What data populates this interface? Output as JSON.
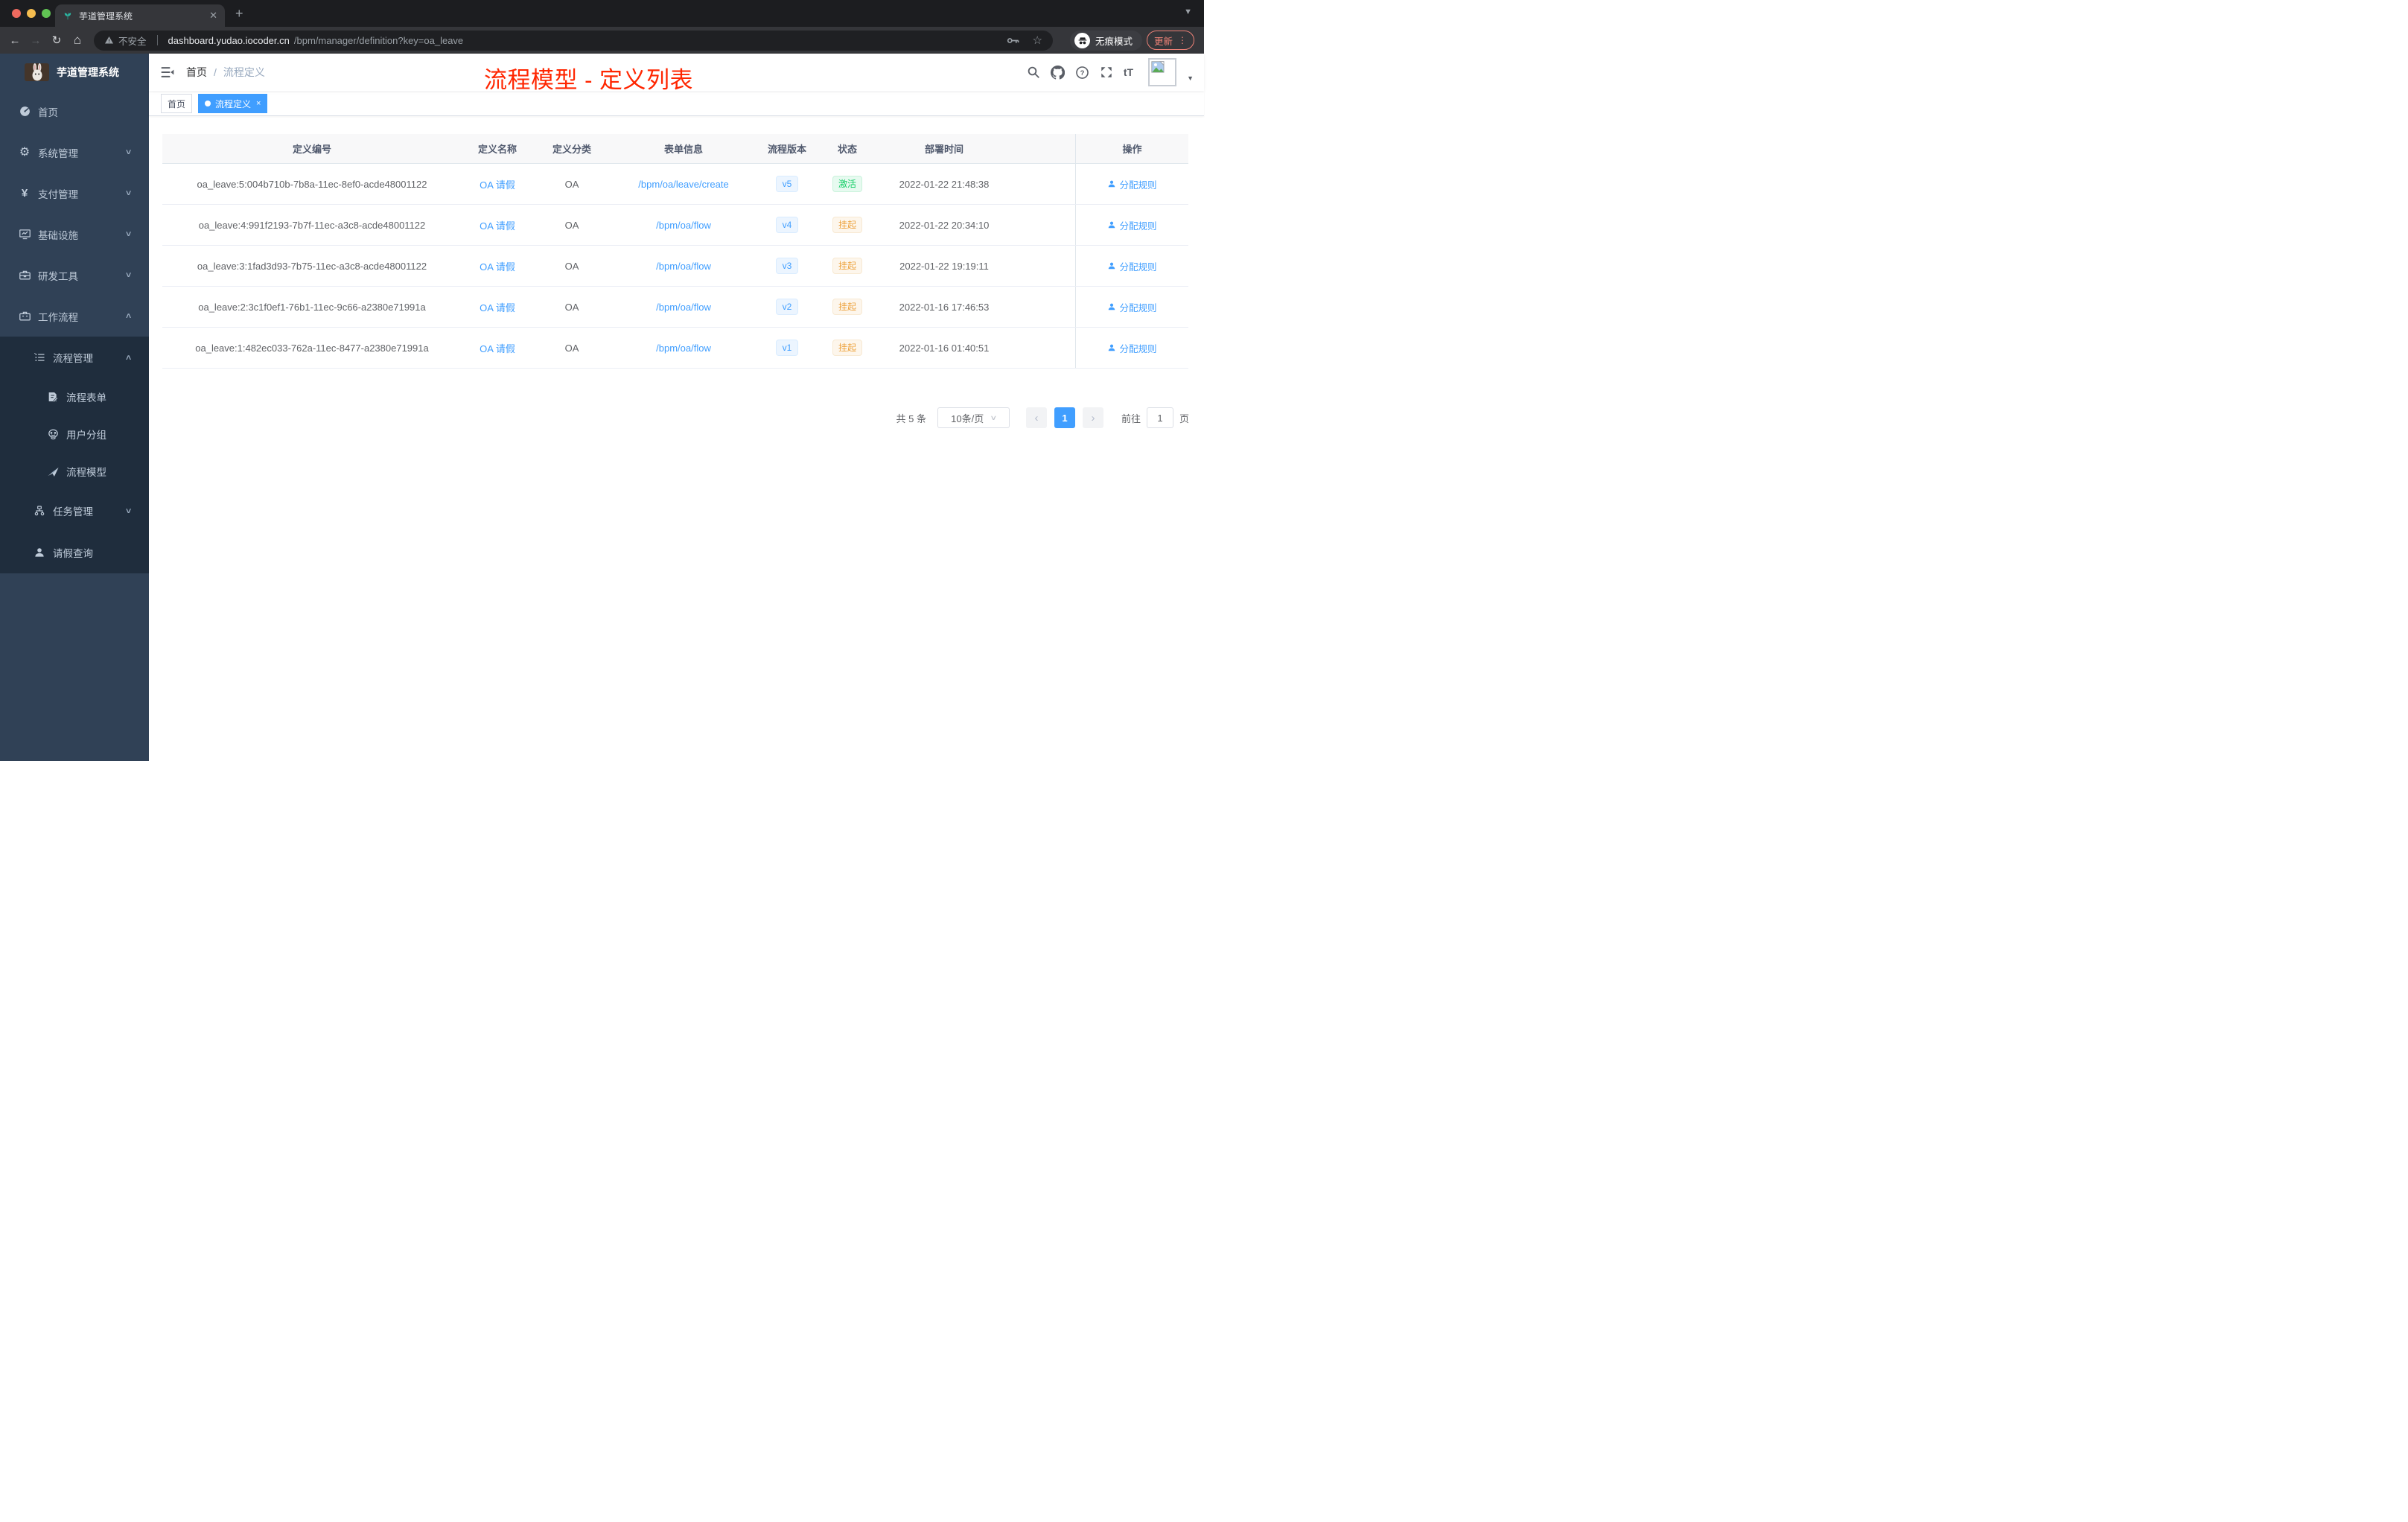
{
  "browser": {
    "tab_title": "芋道管理系统",
    "new_tab_label": "+",
    "close_tab_label": "✕",
    "security_label": "不安全",
    "url_host": "dashboard.yudao.iocoder.cn",
    "url_path": "/bpm/manager/definition?key=oa_leave",
    "incognito_label": "无痕模式",
    "update_label": "更新",
    "back_glyph": "←",
    "forward_glyph": "→",
    "reload_glyph": "↻",
    "home_glyph": "⌂"
  },
  "sidebar": {
    "app_title": "芋道管理系统",
    "items": [
      "首页",
      "系统管理",
      "支付管理",
      "基础设施",
      "研发工具",
      "工作流程"
    ],
    "submenu": [
      "流程管理",
      "流程表单",
      "用户分组",
      "流程模型",
      "任务管理",
      "请假查询"
    ]
  },
  "header": {
    "breadcrumb_home": "首页",
    "breadcrumb_current": "流程定义",
    "annotation": "流程模型 - 定义列表",
    "font_size_label": "tT"
  },
  "tags": {
    "home": "首页",
    "active": "流程定义",
    "close_glyph": "×"
  },
  "table": {
    "columns": [
      "定义编号",
      "定义名称",
      "定义分类",
      "表单信息",
      "流程版本",
      "状态",
      "部署时间",
      "操作"
    ],
    "rows": [
      {
        "id": "oa_leave:5:004b710b-7b8a-11ec-8ef0-acde48001122",
        "name": "OA 请假",
        "category": "OA",
        "form": "/bpm/oa/leave/create",
        "version": "v5",
        "status": "激活",
        "deployed_at": "2022-01-22 21:48:38",
        "action": "分配规则"
      },
      {
        "id": "oa_leave:4:991f2193-7b7f-11ec-a3c8-acde48001122",
        "name": "OA 请假",
        "category": "OA",
        "form": "/bpm/oa/flow",
        "version": "v4",
        "status": "挂起",
        "deployed_at": "2022-01-22 20:34:10",
        "action": "分配规则"
      },
      {
        "id": "oa_leave:3:1fad3d93-7b75-11ec-a3c8-acde48001122",
        "name": "OA 请假",
        "category": "OA",
        "form": "/bpm/oa/flow",
        "version": "v3",
        "status": "挂起",
        "deployed_at": "2022-01-22 19:19:11",
        "action": "分配规则"
      },
      {
        "id": "oa_leave:2:3c1f0ef1-76b1-11ec-9c66-a2380e71991a",
        "name": "OA 请假",
        "category": "OA",
        "form": "/bpm/oa/flow",
        "version": "v2",
        "status": "挂起",
        "deployed_at": "2022-01-16 17:46:53",
        "action": "分配规则"
      },
      {
        "id": "oa_leave:1:482ec033-762a-11ec-8477-a2380e71991a",
        "name": "OA 请假",
        "category": "OA",
        "form": "/bpm/oa/flow",
        "version": "v1",
        "status": "挂起",
        "deployed_at": "2022-01-16 01:40:51",
        "action": "分配规则"
      }
    ]
  },
  "pagination": {
    "total": "共 5 条",
    "page_size": "10条/页",
    "prev": "‹",
    "current_page": "1",
    "next": "›",
    "goto_label": "前往",
    "goto_value": "1",
    "unit_label": "页"
  },
  "colors": {
    "accent": "#409eff",
    "status_active": "#13ce66",
    "status_suspended": "#eda23c",
    "annotation_red": "#ff2601",
    "sidebar_bg": "#304156",
    "submenu_bg": "#1f2d3d"
  }
}
